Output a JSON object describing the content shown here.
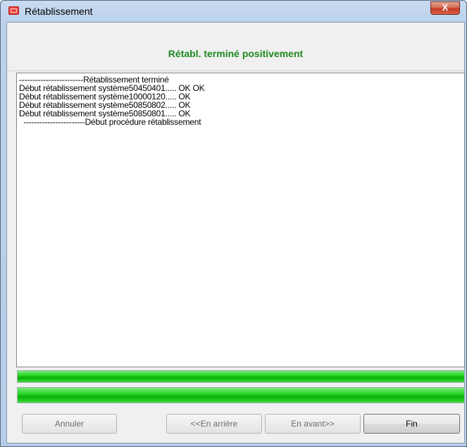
{
  "window": {
    "title": "Rétablissement",
    "app_icon": "app-logo-icon",
    "close_label": "X"
  },
  "header": {
    "status": "Rétabl. terminé positivement",
    "status_color": "#1f8a1f"
  },
  "log": {
    "lines": [
      "------------------------Rétablissement terminé",
      "Début rétablissement système50450401..... OK OK",
      "Début rétablissement système10000120..... OK",
      "Début rétablissement système50850802..... OK",
      "Début rétablissement système50850801..... OK",
      "  -----------------------Début procédure rétablissement"
    ]
  },
  "progress": {
    "bars": [
      {
        "fraction": 1.0
      },
      {
        "fraction": 1.0
      }
    ],
    "fill_color": "#18c618"
  },
  "buttons": {
    "cancel_label": "Annuler",
    "back_label": "<<En arrière",
    "forward_label": "En avant>>",
    "finish_label": "Fin"
  }
}
